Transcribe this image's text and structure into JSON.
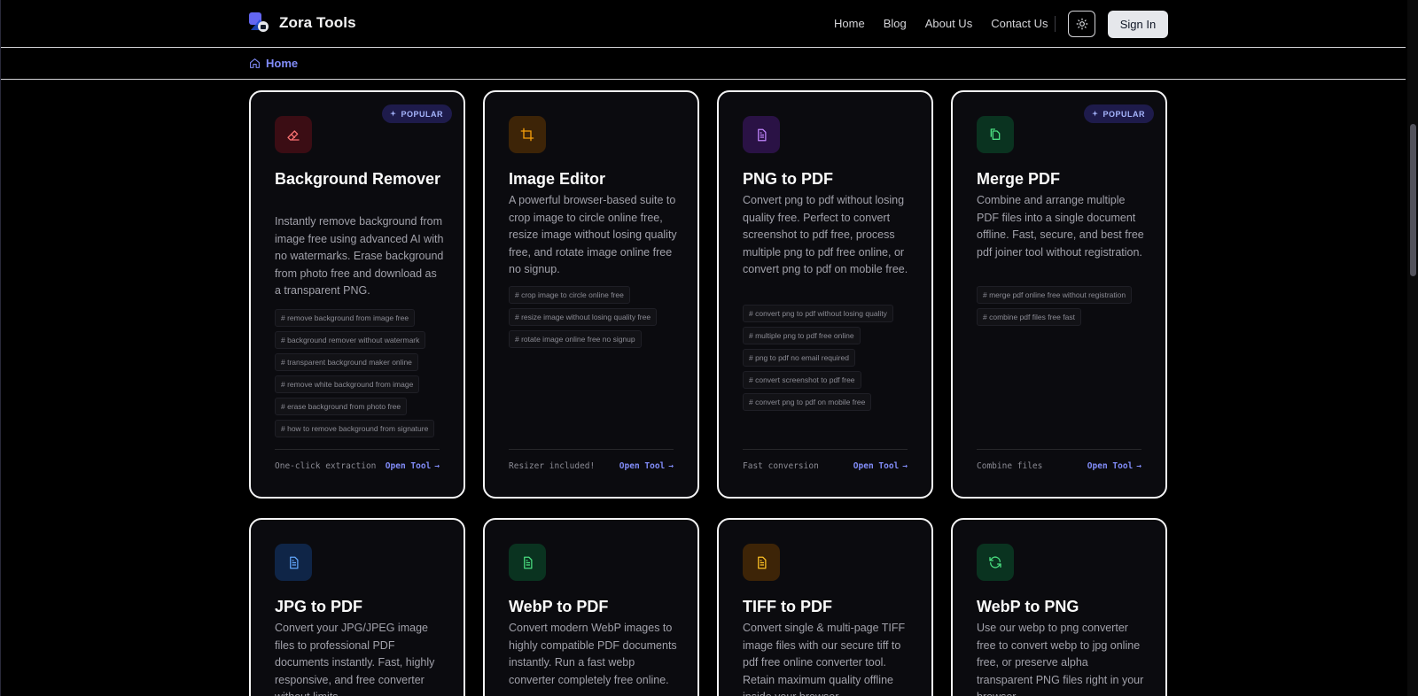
{
  "header": {
    "brand": "Zora Tools",
    "nav": [
      "Home",
      "Blog",
      "About Us",
      "Contact Us"
    ],
    "sign_in": "Sign In"
  },
  "breadcrumb": {
    "home": "Home"
  },
  "badge_label": "POPULAR",
  "cards": [
    {
      "title": "Background Remover",
      "desc": "Instantly remove background from image free using advanced AI with no watermarks. Erase background from photo free and download as a transparent PNG.",
      "tags": [
        "# remove background from image free",
        "# background remover without watermark",
        "# transparent background maker online",
        "# remove white background from image",
        "# erase background from photo free",
        "# how to remove background from signature"
      ],
      "foot_note": "One-click extraction",
      "link": "Open Tool",
      "icon": "eraser-icon",
      "color": "#f87171",
      "bg": "#3b0d14"
    },
    {
      "title": "Image Editor",
      "desc": "A powerful browser-based suite to crop image to circle online free, resize image without losing quality free, and rotate image online free no signup.",
      "tags": [
        "# crop image to circle online free",
        "# resize image without losing quality free",
        "# rotate image online free no signup"
      ],
      "foot_note": "Resizer included!",
      "link": "Open Tool",
      "icon": "crop-icon",
      "color": "#f59e0b",
      "bg": "#3d2407"
    },
    {
      "title": "PNG to PDF",
      "desc": "Convert png to pdf without losing quality free. Perfect to convert screenshot to pdf free, process multiple png to pdf free online, or convert png to pdf on mobile free.",
      "tags": [
        "# convert png to pdf without losing quality",
        "# multiple png to pdf free online",
        "# png to pdf no email required",
        "# convert screenshot to pdf free",
        "# convert png to pdf on mobile free"
      ],
      "foot_note": "Fast conversion",
      "link": "Open Tool",
      "icon": "document-icon",
      "color": "#c084fc",
      "bg": "#2a1245"
    },
    {
      "title": "Merge PDF",
      "desc": "Combine and arrange multiple PDF files into a single document offline. Fast, secure, and best free pdf joiner tool without registration.",
      "tags": [
        "# merge pdf online free without registration",
        "# combine pdf files free fast"
      ],
      "foot_note": "Combine files",
      "link": "Open Tool",
      "icon": "copy-files-icon",
      "color": "#4ade80",
      "bg": "#0a3320"
    },
    {
      "title": "JPG to PDF",
      "desc": "Convert your JPG/JPEG image files to professional PDF documents instantly. Fast, highly responsive, and free converter without limits.",
      "icon": "document-icon",
      "color": "#60a5fa",
      "bg": "#0f2547"
    },
    {
      "title": "WebP to PDF",
      "desc": "Convert modern WebP images to highly compatible PDF documents instantly. Run a fast webp converter completely free online.",
      "icon": "document-icon",
      "color": "#4ade80",
      "bg": "#0a3320"
    },
    {
      "title": "TIFF to PDF",
      "desc": "Convert single & multi-page TIFF image files with our secure tiff to pdf free online converter tool. Retain maximum quality offline inside your browser.",
      "icon": "document-icon",
      "color": "#fbbf24",
      "bg": "#3d2407"
    },
    {
      "title": "WebP to PNG",
      "desc": "Use our webp to png converter free to convert webp to jpg online free, or preserve alpha transparent PNG files right in your browser.",
      "icon": "refresh-icon",
      "color": "#4ade80",
      "bg": "#0a3320"
    }
  ]
}
